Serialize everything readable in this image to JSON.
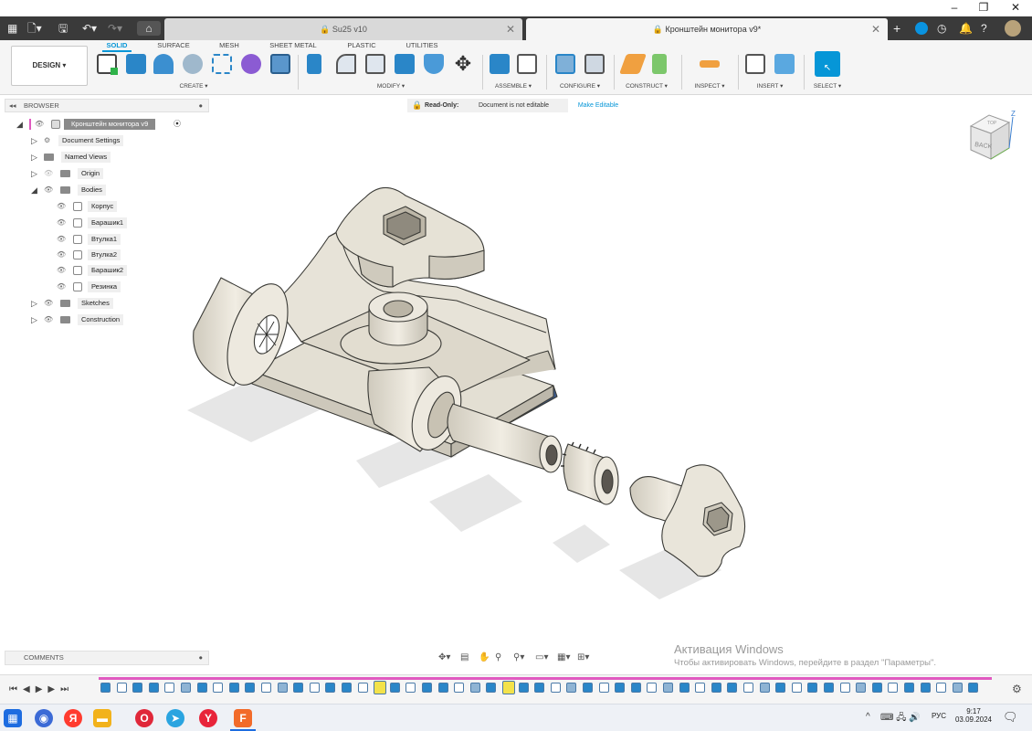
{
  "window": {
    "minimize": "–",
    "restore": "❐",
    "close": "✕"
  },
  "tabs": [
    {
      "label": "Su25 v10",
      "close": "✕"
    },
    {
      "label": "Кронштейн монитора v9*",
      "close": "✕"
    }
  ],
  "workspace": {
    "label": "DESIGN ▾"
  },
  "workspace_tabs": [
    "SOLID",
    "SURFACE",
    "MESH",
    "SHEET METAL",
    "PLASTIC",
    "UTILITIES"
  ],
  "groups": [
    "CREATE ▾",
    "MODIFY ▾",
    "ASSEMBLE ▾",
    "CONFIGURE ▾",
    "CONSTRUCT ▾",
    "INSPECT ▾",
    "INSERT ▾",
    "SELECT ▾"
  ],
  "browser": {
    "title": "BROWSER",
    "root": "Кронштейн монитора v9",
    "items": [
      {
        "label": "Document Settings"
      },
      {
        "label": "Named Views"
      },
      {
        "label": "Origin"
      },
      {
        "label": "Bodies"
      },
      {
        "label": "Корпус"
      },
      {
        "label": "Барашик1"
      },
      {
        "label": "Втулка1"
      },
      {
        "label": "Втулка2"
      },
      {
        "label": "Барашик2"
      },
      {
        "label": "Резинка"
      },
      {
        "label": "Sketches"
      },
      {
        "label": "Construction"
      }
    ]
  },
  "readonly": {
    "tag": "Read-Only:",
    "message": "Document is not editable",
    "action": "Make Editable"
  },
  "viewcube": {
    "face": "BACK",
    "top": "TOP",
    "z": "Z"
  },
  "comments": {
    "label": "COMMENTS"
  },
  "activation": {
    "title": "Активация Windows",
    "text": "Чтобы активировать Windows, перейдите в раздел \"Параметры\"."
  },
  "taskbar": {
    "lang": "РУС",
    "time": "9:17",
    "date": "03.09.2024"
  },
  "colors": {
    "accent": "#0696d7",
    "model": "#eae6da",
    "model_stroke": "#3a3a36",
    "pad": "#3b5a8c"
  }
}
